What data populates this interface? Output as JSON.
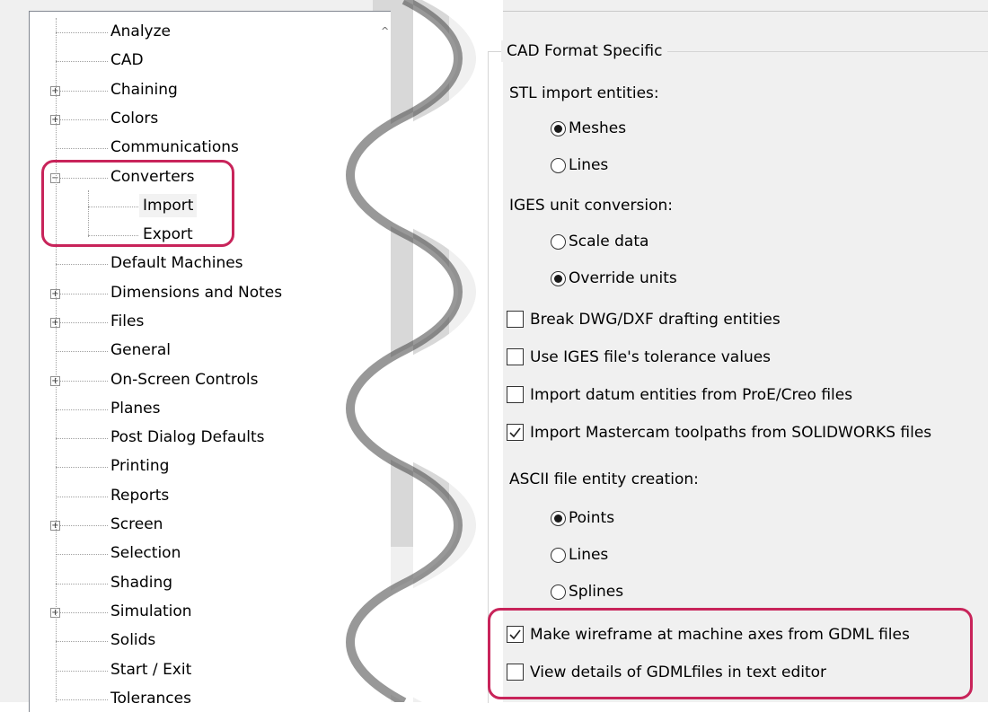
{
  "tree": {
    "items": [
      {
        "label": "Analyze",
        "expandable": false
      },
      {
        "label": "CAD",
        "expandable": false
      },
      {
        "label": "Chaining",
        "expandable": true
      },
      {
        "label": "Colors",
        "expandable": true
      },
      {
        "label": "Communications",
        "expandable": false
      },
      {
        "label": "Converters",
        "expandable": true,
        "expanded": true
      },
      {
        "label": "Import",
        "child": true,
        "selected": true
      },
      {
        "label": "Export",
        "child": true
      },
      {
        "label": "Default Machines",
        "expandable": false
      },
      {
        "label": "Dimensions and Notes",
        "expandable": true
      },
      {
        "label": "Files",
        "expandable": true
      },
      {
        "label": "General",
        "expandable": false
      },
      {
        "label": "On-Screen Controls",
        "expandable": true
      },
      {
        "label": "Planes",
        "expandable": false
      },
      {
        "label": "Post Dialog Defaults",
        "expandable": false
      },
      {
        "label": "Printing",
        "expandable": false
      },
      {
        "label": "Reports",
        "expandable": false
      },
      {
        "label": "Screen",
        "expandable": true
      },
      {
        "label": "Selection",
        "expandable": false
      },
      {
        "label": "Shading",
        "expandable": false
      },
      {
        "label": "Simulation",
        "expandable": true
      },
      {
        "label": "Solids",
        "expandable": false
      },
      {
        "label": "Start / Exit",
        "expandable": false
      },
      {
        "label": "Tolerances",
        "expandable": false
      }
    ],
    "expand_glyph": "+",
    "collapse_glyph": "−",
    "scroll_glyph": "^"
  },
  "panel": {
    "group_title": "CAD Format Specific",
    "stl_label": "STL import entities:",
    "stl_meshes": "Meshes",
    "stl_lines": "Lines",
    "stl_selected": "Meshes",
    "iges_label": "IGES unit conversion:",
    "iges_scale": "Scale data",
    "iges_override": "Override units",
    "iges_selected": "Override units",
    "chk_break_dwg": "Break DWG/DXF drafting entities",
    "chk_break_dwg_checked": false,
    "chk_iges_tol": "Use IGES file's tolerance values",
    "chk_iges_tol_checked": false,
    "chk_datum": "Import datum entities from ProE/Creo files",
    "chk_datum_checked": false,
    "chk_toolpaths": "Import Mastercam toolpaths from SOLIDWORKS files",
    "chk_toolpaths_checked": true,
    "ascii_label": "ASCII file entity creation:",
    "ascii_points": "Points",
    "ascii_lines": "Lines",
    "ascii_splines": "Splines",
    "ascii_selected": "Points",
    "chk_wireframe": "Make wireframe at machine axes from GDML files",
    "chk_wireframe_checked": true,
    "chk_view_gdml": "View details of GDMLfiles in text editor",
    "chk_view_gdml_checked": false
  },
  "colors": {
    "highlight": "#c8245a"
  }
}
